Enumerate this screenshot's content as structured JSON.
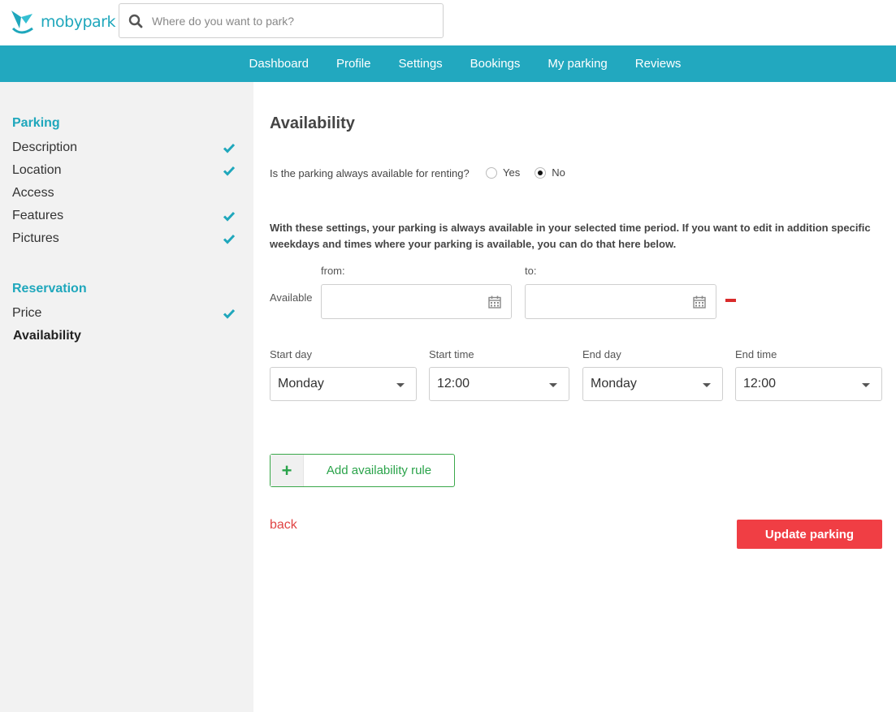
{
  "brand": {
    "name": "mobypark",
    "color": "#1fa7bc"
  },
  "search": {
    "placeholder": "Where do you want to park?",
    "icon": "search-icon"
  },
  "nav": {
    "items": [
      {
        "label": "Dashboard"
      },
      {
        "label": "Profile"
      },
      {
        "label": "Settings"
      },
      {
        "label": "Bookings"
      },
      {
        "label": "My parking"
      },
      {
        "label": "Reviews"
      }
    ],
    "background": "#22a8bf"
  },
  "sidebar": {
    "parking": {
      "heading": "Parking",
      "items": [
        {
          "label": "Description",
          "done": true
        },
        {
          "label": "Location",
          "done": true
        },
        {
          "label": "Access",
          "done": false
        },
        {
          "label": "Features",
          "done": true
        },
        {
          "label": "Pictures",
          "done": true
        }
      ]
    },
    "reservation": {
      "heading": "Reservation",
      "items": [
        {
          "label": "Price",
          "done": true
        },
        {
          "label": "Availability",
          "done": false,
          "active": true
        }
      ]
    }
  },
  "main": {
    "title": "Availability",
    "question": "Is the parking always available for renting?",
    "options": [
      {
        "label": "Yes",
        "checked": false
      },
      {
        "label": "No",
        "checked": true
      }
    ],
    "info": "With these settings, your parking is always available in your selected time period. If you want to edit in addition specific weekdays and times where your parking is available, you can do that here below.",
    "available_label": "Available",
    "from_label": "from:",
    "to_label": "to:",
    "from_value": "",
    "to_value": "",
    "rule": {
      "start_day_label": "Start day",
      "start_day": "Monday",
      "start_time_label": "Start time",
      "start_time": "12:00",
      "end_day_label": "End day",
      "end_day": "Monday",
      "end_time_label": "End time",
      "end_time": "12:00"
    },
    "add_rule_label": "Add availability rule",
    "back_label": "back",
    "update_label": "Update parking"
  },
  "colors": {
    "accent": "#1fa7bc",
    "success": "#2aa34a",
    "danger": "#f03e44"
  }
}
